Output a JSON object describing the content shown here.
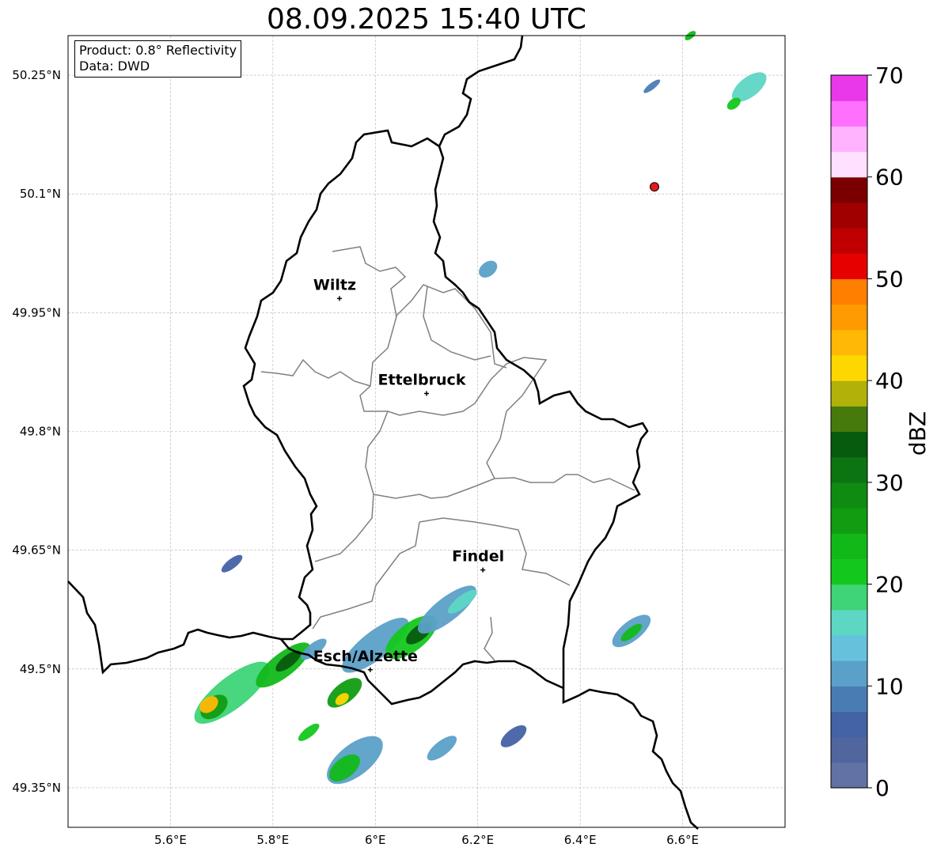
{
  "title": "08.09.2025 15:40 UTC",
  "info": {
    "product": "Product: 0.8° Reflectivity",
    "source": "Data: DWD"
  },
  "map": {
    "lon_range": [
      5.4,
      6.8
    ],
    "lat_range": [
      49.3,
      50.3
    ],
    "lon_ticks": [
      {
        "value": 5.6,
        "label": "5.6°E"
      },
      {
        "value": 5.8,
        "label": "5.8°E"
      },
      {
        "value": 6.0,
        "label": "6°E"
      },
      {
        "value": 6.2,
        "label": "6.2°E"
      },
      {
        "value": 6.4,
        "label": "6.4°E"
      },
      {
        "value": 6.6,
        "label": "6.6°E"
      }
    ],
    "lat_ticks": [
      {
        "value": 49.35,
        "label": "49.35°N"
      },
      {
        "value": 49.5,
        "label": "49.5°N"
      },
      {
        "value": 49.65,
        "label": "49.65°N"
      },
      {
        "value": 49.8,
        "label": "49.8°N"
      },
      {
        "value": 49.95,
        "label": "49.95°N"
      },
      {
        "value": 50.1,
        "label": "50.1°N"
      },
      {
        "value": 50.25,
        "label": "50.25°N"
      }
    ],
    "cities": [
      {
        "name": "Wiltz",
        "lon": 5.93,
        "lat": 49.968
      },
      {
        "name": "Ettelbruck",
        "lon": 6.1,
        "lat": 49.848
      },
      {
        "name": "Findel",
        "lon": 6.21,
        "lat": 49.625
      },
      {
        "name": "Esch/Alzette",
        "lon": 5.99,
        "lat": 49.499
      }
    ],
    "radar_site": {
      "lon": 6.545,
      "lat": 50.109,
      "color": "#e41a1c"
    },
    "echoes": [
      {
        "lon": 5.72,
        "lat": 49.47,
        "len": 0.18,
        "wid": 0.04,
        "dbz": 18
      },
      {
        "lon": 5.685,
        "lat": 49.452,
        "len": 0.06,
        "wid": 0.025,
        "dbz": 26
      },
      {
        "lon": 5.675,
        "lat": 49.455,
        "len": 0.04,
        "wid": 0.018,
        "dbz": 44
      },
      {
        "lon": 5.82,
        "lat": 49.505,
        "len": 0.13,
        "wid": 0.03,
        "dbz": 24
      },
      {
        "lon": 5.83,
        "lat": 49.51,
        "len": 0.06,
        "wid": 0.015,
        "dbz": 33
      },
      {
        "lon": 5.88,
        "lat": 49.525,
        "len": 0.06,
        "wid": 0.015,
        "dbz": 12
      },
      {
        "lon": 5.94,
        "lat": 49.47,
        "len": 0.08,
        "wid": 0.025,
        "dbz": 25
      },
      {
        "lon": 5.935,
        "lat": 49.462,
        "len": 0.03,
        "wid": 0.012,
        "dbz": 40
      },
      {
        "lon": 6.0,
        "lat": 49.53,
        "len": 0.16,
        "wid": 0.035,
        "dbz": 10
      },
      {
        "lon": 6.07,
        "lat": 49.54,
        "len": 0.12,
        "wid": 0.035,
        "dbz": 22
      },
      {
        "lon": 6.085,
        "lat": 49.545,
        "len": 0.06,
        "wid": 0.018,
        "dbz": 33
      },
      {
        "lon": 6.14,
        "lat": 49.575,
        "len": 0.14,
        "wid": 0.03,
        "dbz": 12
      },
      {
        "lon": 6.17,
        "lat": 49.585,
        "len": 0.07,
        "wid": 0.015,
        "dbz": 16
      },
      {
        "lon": 5.96,
        "lat": 49.385,
        "len": 0.13,
        "wid": 0.04,
        "dbz": 10
      },
      {
        "lon": 5.94,
        "lat": 49.375,
        "len": 0.07,
        "wid": 0.025,
        "dbz": 23
      },
      {
        "lon": 5.87,
        "lat": 49.42,
        "len": 0.05,
        "wid": 0.012,
        "dbz": 20
      },
      {
        "lon": 6.13,
        "lat": 49.4,
        "len": 0.07,
        "wid": 0.018,
        "dbz": 11
      },
      {
        "lon": 6.27,
        "lat": 49.415,
        "len": 0.06,
        "wid": 0.018,
        "dbz": 6
      },
      {
        "lon": 6.5,
        "lat": 49.548,
        "len": 0.09,
        "wid": 0.025,
        "dbz": 12
      },
      {
        "lon": 6.5,
        "lat": 49.546,
        "len": 0.05,
        "wid": 0.012,
        "dbz": 24
      },
      {
        "lon": 5.72,
        "lat": 49.633,
        "len": 0.05,
        "wid": 0.012,
        "dbz": 7
      },
      {
        "lon": 6.22,
        "lat": 50.005,
        "len": 0.04,
        "wid": 0.018,
        "dbz": 11
      },
      {
        "lon": 6.54,
        "lat": 50.236,
        "len": 0.04,
        "wid": 0.008,
        "dbz": 8
      },
      {
        "lon": 6.73,
        "lat": 50.235,
        "len": 0.08,
        "wid": 0.025,
        "dbz": 15
      },
      {
        "lon": 6.7,
        "lat": 50.214,
        "len": 0.03,
        "wid": 0.012,
        "dbz": 22
      },
      {
        "lon": 6.615,
        "lat": 50.3,
        "len": 0.025,
        "wid": 0.008,
        "dbz": 24
      }
    ]
  },
  "colorbar": {
    "label": "dBZ",
    "min": 0,
    "max": 70,
    "tick_values": [
      0,
      10,
      20,
      30,
      40,
      50,
      60,
      70
    ],
    "tick_labels": [
      "0",
      "10",
      "20",
      "30",
      "40",
      "50",
      "60",
      "70"
    ],
    "colors": [
      "#6272a4",
      "#51669f",
      "#4462a6",
      "#4a7cb4",
      "#5ba0c8",
      "#66c2dc",
      "#5dd6c4",
      "#3ed477",
      "#14c71d",
      "#12b81a",
      "#119c12",
      "#0f8b12",
      "#0c7511",
      "#075b0e",
      "#467a0d",
      "#b0b20a",
      "#ffd700",
      "#ffb805",
      "#ff9a00",
      "#ff7f00",
      "#e60000",
      "#c00000",
      "#a00000",
      "#7a0000",
      "#ffe0ff",
      "#ffb3ff",
      "#ff70ff",
      "#e838e8"
    ]
  }
}
